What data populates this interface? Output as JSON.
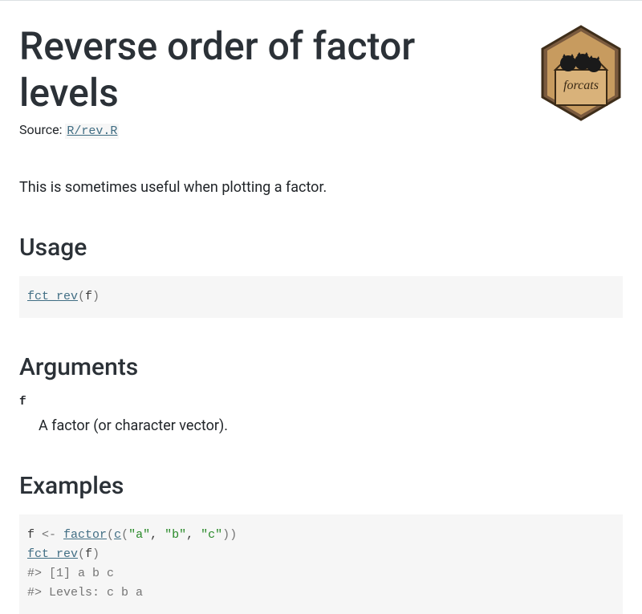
{
  "header": {
    "title": "Reverse order of factor levels",
    "source_label": "Source: ",
    "source_link_text": "R/rev.R"
  },
  "description": "This is sometimes useful when plotting a factor.",
  "sections": {
    "usage_heading": "Usage",
    "arguments_heading": "Arguments",
    "examples_heading": "Examples"
  },
  "usage_code": {
    "fn": "fct_rev",
    "open": "(",
    "arg": "f",
    "close": ")"
  },
  "arguments": {
    "name": "f",
    "desc": "A factor (or character vector)."
  },
  "examples_code": {
    "line1": {
      "var": "f",
      "assign": " <- ",
      "fn": "factor",
      "open": "(",
      "inner_fn": "c",
      "open2": "(",
      "s1": "\"a\"",
      "comma1": ", ",
      "s2": "\"b\"",
      "comma2": ", ",
      "s3": "\"c\"",
      "close2": ")",
      "close": ")"
    },
    "line2": {
      "fn": "fct_rev",
      "open": "(",
      "arg": "f",
      "close": ")"
    },
    "line3": "#> [1] a b c",
    "line4": "#> Levels: c b a"
  },
  "logo": {
    "label": "forcats"
  }
}
